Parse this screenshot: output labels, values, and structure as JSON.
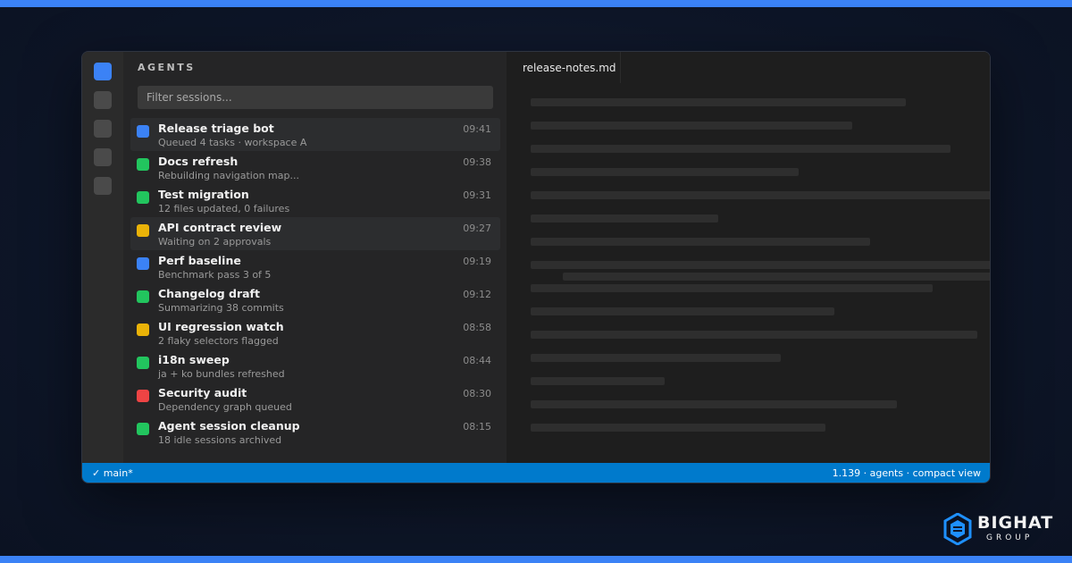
{
  "sidebar": {
    "title": "AGENTS",
    "filter_placeholder": "Filter sessions...",
    "sessions": [
      {
        "name": "Release triage bot",
        "desc": "Queued 4 tasks · workspace A",
        "time": "09:41",
        "color": "#3b82f6",
        "highlighted": true
      },
      {
        "name": "Docs refresh",
        "desc": "Rebuilding navigation map...",
        "time": "09:38",
        "color": "#22c55e",
        "highlighted": false
      },
      {
        "name": "Test migration",
        "desc": "12 files updated, 0 failures",
        "time": "09:31",
        "color": "#22c55e",
        "highlighted": false
      },
      {
        "name": "API contract review",
        "desc": "Waiting on 2 approvals",
        "time": "09:27",
        "color": "#eab308",
        "highlighted": true
      },
      {
        "name": "Perf baseline",
        "desc": "Benchmark pass 3 of 5",
        "time": "09:19",
        "color": "#3b82f6",
        "highlighted": false
      },
      {
        "name": "Changelog draft",
        "desc": "Summarizing 38 commits",
        "time": "09:12",
        "color": "#22c55e",
        "highlighted": false
      },
      {
        "name": "UI regression watch",
        "desc": "2 flaky selectors flagged",
        "time": "08:58",
        "color": "#eab308",
        "highlighted": false
      },
      {
        "name": "i18n sweep",
        "desc": "ja + ko bundles refreshed",
        "time": "08:44",
        "color": "#22c55e",
        "highlighted": false
      },
      {
        "name": "Security audit",
        "desc": "Dependency graph queued",
        "time": "08:30",
        "color": "#ef4444",
        "highlighted": false
      },
      {
        "name": "Agent session cleanup",
        "desc": "18 idle sessions archived",
        "time": "08:15",
        "color": "#22c55e",
        "highlighted": false
      }
    ]
  },
  "editor": {
    "tab_label": "release-notes.md"
  },
  "status_bar": {
    "branch": "✓ main*",
    "right": "1.139 · agents · compact view"
  },
  "logo": {
    "name": "BIGHAT",
    "sub": "GROUP"
  },
  "colors": {
    "accent": "#3b82f6",
    "status_bar": "#007acc"
  }
}
